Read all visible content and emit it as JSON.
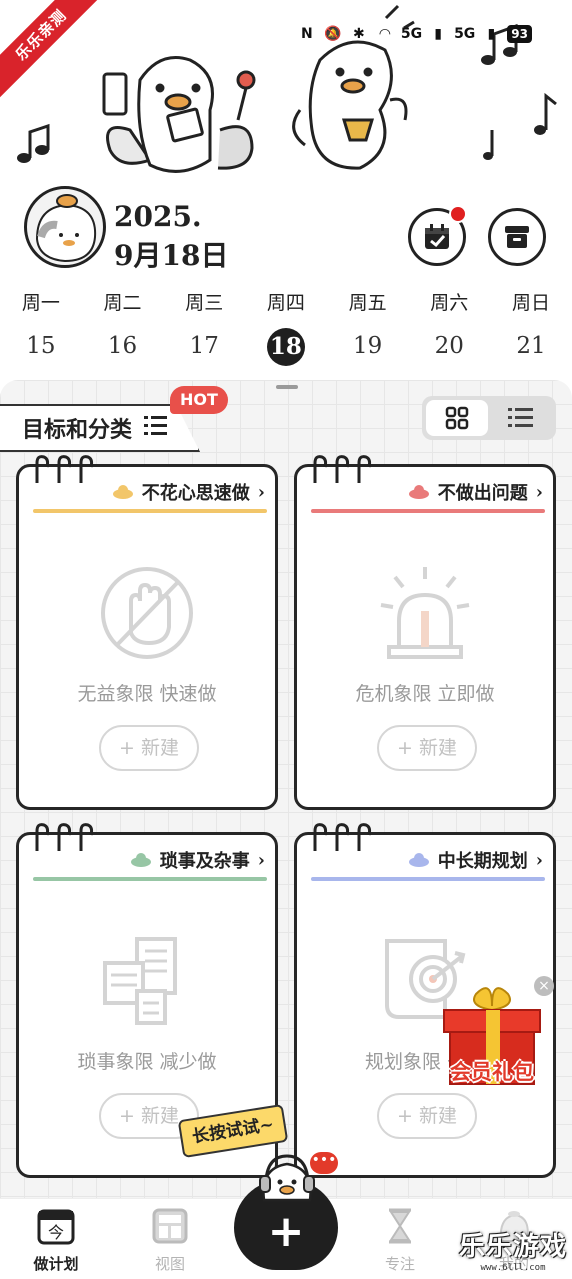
{
  "watermark_ribbon": "乐乐亲测",
  "status_bar": {
    "icons": [
      "nfc-icon",
      "mute-icon",
      "bluetooth-icon",
      "wifi-icon",
      "signal-5g-icon",
      "signal-5g-icon"
    ],
    "net1": "5G",
    "net2": "5G",
    "battery": "93"
  },
  "header": {
    "year": "2025.",
    "date": "9月18日",
    "buttons": [
      {
        "name": "calendar-check-button",
        "icon": "calendar-check-icon",
        "has_badge": true
      },
      {
        "name": "archive-box-button",
        "icon": "archive-box-icon",
        "has_badge": false
      }
    ]
  },
  "week": {
    "days": [
      {
        "weekday": "周一",
        "num": "15",
        "active": false
      },
      {
        "weekday": "周二",
        "num": "16",
        "active": false
      },
      {
        "weekday": "周三",
        "num": "17",
        "active": false
      },
      {
        "weekday": "周四",
        "num": "18",
        "active": true
      },
      {
        "weekday": "周五",
        "num": "19",
        "active": false
      },
      {
        "weekday": "周六",
        "num": "20",
        "active": false
      },
      {
        "weekday": "周日",
        "num": "21",
        "active": false
      }
    ]
  },
  "section": {
    "title": "目标和分类",
    "hot_badge": "HOT"
  },
  "colors": {
    "yellow": "#f2c66a",
    "red": "#e97a7a",
    "green": "#97c6a5",
    "blue": "#a8b6ec",
    "accent_dark": "#1f1f1f"
  },
  "quadrants": [
    {
      "title": "不花心思速做",
      "desc": "无益象限 快速做",
      "new_label": "+ 新建",
      "color": "yellow",
      "icon": "no-hand-icon"
    },
    {
      "title": "不做出问题",
      "desc": "危机象限 立即做",
      "new_label": "+ 新建",
      "color": "red",
      "icon": "alarm-siren-icon"
    },
    {
      "title": "琐事及杂事",
      "desc": "琐事象限 减少做",
      "new_label": "+ 新建",
      "color": "green",
      "icon": "papers-icon"
    },
    {
      "title": "中长期规划",
      "desc": "规划象限 去做",
      "new_label": "+ 新建",
      "color": "blue",
      "icon": "target-scroll-icon"
    }
  ],
  "promo": {
    "gift_label": "会员礼包",
    "close": "×",
    "tip": "长按试试~"
  },
  "bottom_nav": {
    "items": [
      {
        "label": "做计划",
        "icon_text": "今",
        "active": true
      },
      {
        "label": "视图",
        "active": false
      },
      {
        "label": "专注",
        "active": false
      },
      {
        "label": "我的",
        "active": false
      }
    ],
    "fab": "+"
  },
  "site_watermark": {
    "name": "乐乐游戏",
    "url": "www.6lll.com"
  }
}
